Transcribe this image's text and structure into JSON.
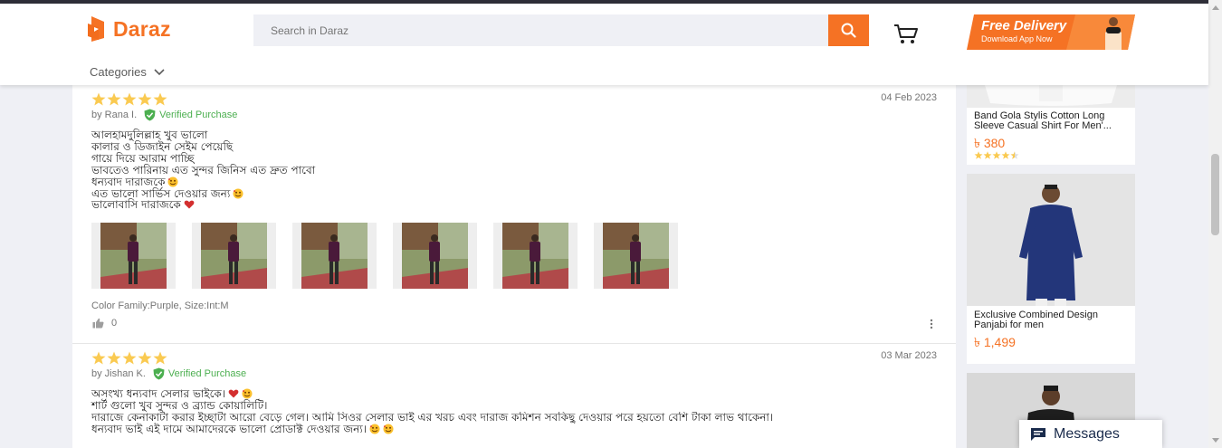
{
  "header": {
    "logo_text": "Daraz",
    "search_placeholder": "Search in Daraz",
    "promo": {
      "title": "Free Delivery",
      "subtitle": "Download App Now"
    },
    "categories_label": "Categories"
  },
  "reviews": [
    {
      "rating": 5,
      "date": "04 Feb 2023",
      "author": "by Rana I.",
      "verified_label": "Verified Purchase",
      "lines": [
        {
          "text": "আলহামদুলিল্লাহ খুব ভালো",
          "emoji": ""
        },
        {
          "text": "কালার ও ডিজাইন সেইম পেয়েছি",
          "emoji": ""
        },
        {
          "text": "গায়ে দিয়ে আরাম পাচ্ছি",
          "emoji": ""
        },
        {
          "text": "ভাবতেও পারিনায় এত সুন্দর জিনিস এত দ্রুত পাবো",
          "emoji": ""
        },
        {
          "text": "ধন্যবাদ দারাজকে",
          "emoji": "hearts-face"
        },
        {
          "text": "এত ভালো সার্ভিস দেওয়ার জন্য",
          "emoji": "hearts-face"
        },
        {
          "text": "ভালোবাসি দারাজকে",
          "emoji": "red-heart"
        }
      ],
      "photo_count": 6,
      "sku": "Color Family:Purple, Size:Int:M",
      "likes": "0"
    },
    {
      "rating": 5,
      "date": "03 Mar 2023",
      "author": "by Jishan K.",
      "verified_label": "Verified Purchase",
      "lines": [
        {
          "text": "অসংখ্য ধন্যবাদ সেলার ভাইকে।",
          "emoji": "red-heart+hearts-face"
        },
        {
          "text": "শার্ট গুলো খুব সুন্দর ও ব্র্যান্ড কোয়ালিটি।",
          "emoji": ""
        },
        {
          "text": "দারাজে কেনাকাটা করার ইচ্ছাটা আরো বেড়ে গেল। আমি সিওর সেলার ভাই এর খরচ এবং দারাজ কমিশন সবকিছু দেওয়ার পরে হয়তো বেশি টাকা লাভ থাকেনা।",
          "emoji": ""
        },
        {
          "text": "ধন্যবাদ ভাই এই দামে আমাদেরকে ভালো প্রোডাক্ট দেওয়ার জন্য।",
          "emoji": "hearts-face+hearts-face"
        }
      ]
    }
  ],
  "sidebar": [
    {
      "title": "Band Gola Stylis Cotton Long Sleeve Casual Shirt For Men'...",
      "price": "৳ 380",
      "rating": 4.5
    },
    {
      "title": "Exclusive Combined Design Panjabi for men",
      "price": "৳ 1,499"
    }
  ],
  "messages_label": "Messages",
  "colors": {
    "accent": "#f57224",
    "verified": "#4caf50",
    "star": "#faca51"
  }
}
